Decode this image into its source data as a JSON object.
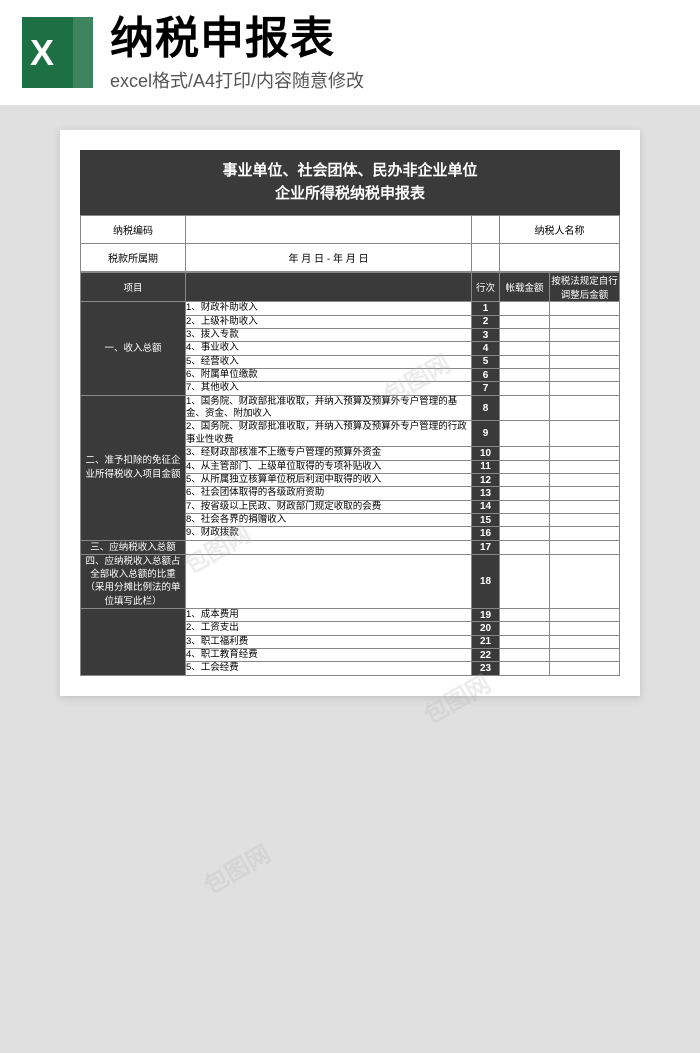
{
  "header": {
    "icon_letter": "X",
    "title": "纳税申报表",
    "subtitle": "excel格式/A4打印/内容随意修改"
  },
  "doc": {
    "title_line1": "事业单位、社会团体、民办非企业单位",
    "title_line2": "企业所得税纳税申报表",
    "meta": {
      "code_label": "纳税编码",
      "name_label": "纳税人名称",
      "period_label": "税款所属期",
      "period_value": "年 月 日 -   年 月 日"
    },
    "cols": {
      "project": "项目",
      "row": "行次",
      "amount": "帐载金额",
      "adjusted": "按税法规定自行调整后金额"
    },
    "sections": [
      {
        "label": "一、收入总额",
        "rows": [
          {
            "n": "1",
            "t": "1、财政补助收入"
          },
          {
            "n": "2",
            "t": "2、上级补助收入"
          },
          {
            "n": "3",
            "t": "3、拨入专款"
          },
          {
            "n": "4",
            "t": "4、事业收入"
          },
          {
            "n": "5",
            "t": "5、经营收入"
          },
          {
            "n": "6",
            "t": "6、附属单位缴款"
          },
          {
            "n": "7",
            "t": "7、其他收入"
          }
        ]
      },
      {
        "label": "二、准予扣除的免征企业所得税收入项目金额",
        "rows": [
          {
            "n": "8",
            "t": "1、国务院、财政部批准收取，并纳入预算及预算外专户管理的基金、资金、附加收入"
          },
          {
            "n": "9",
            "t": "2、国务院、财政部批准收取，并纳入预算及预算外专户管理的行政事业性收费"
          },
          {
            "n": "10",
            "t": "3、经财政部核准不上缴专户管理的预算外资金"
          },
          {
            "n": "11",
            "t": "4、从主管部门、上级单位取得的专项补贴收入"
          },
          {
            "n": "12",
            "t": "5、从所属独立核算单位税后利润中取得的收入"
          },
          {
            "n": "13",
            "t": "6、社会团体取得的各级政府资助"
          },
          {
            "n": "14",
            "t": "7、按省级以上民政、财政部门规定收取的会费"
          },
          {
            "n": "15",
            "t": "8、社会各界的捐赠收入"
          },
          {
            "n": "16",
            "t": "9、财政拨款"
          }
        ]
      },
      {
        "label": "三、应纳税收入总额",
        "rows": [
          {
            "n": "17",
            "t": ""
          }
        ]
      },
      {
        "label": "四、应纳税收入总额占全部收入总额的比重（采用分摊比例法的单位填写此栏）",
        "rows": [
          {
            "n": "18",
            "t": ""
          }
        ]
      },
      {
        "label": "",
        "rows": [
          {
            "n": "19",
            "t": "1、成本费用"
          },
          {
            "n": "20",
            "t": "2、工资支出"
          },
          {
            "n": "21",
            "t": "3、职工福利费"
          },
          {
            "n": "22",
            "t": "4、职工教育经费"
          },
          {
            "n": "23",
            "t": "5、工会经费"
          }
        ]
      }
    ]
  },
  "watermark": "包图网"
}
